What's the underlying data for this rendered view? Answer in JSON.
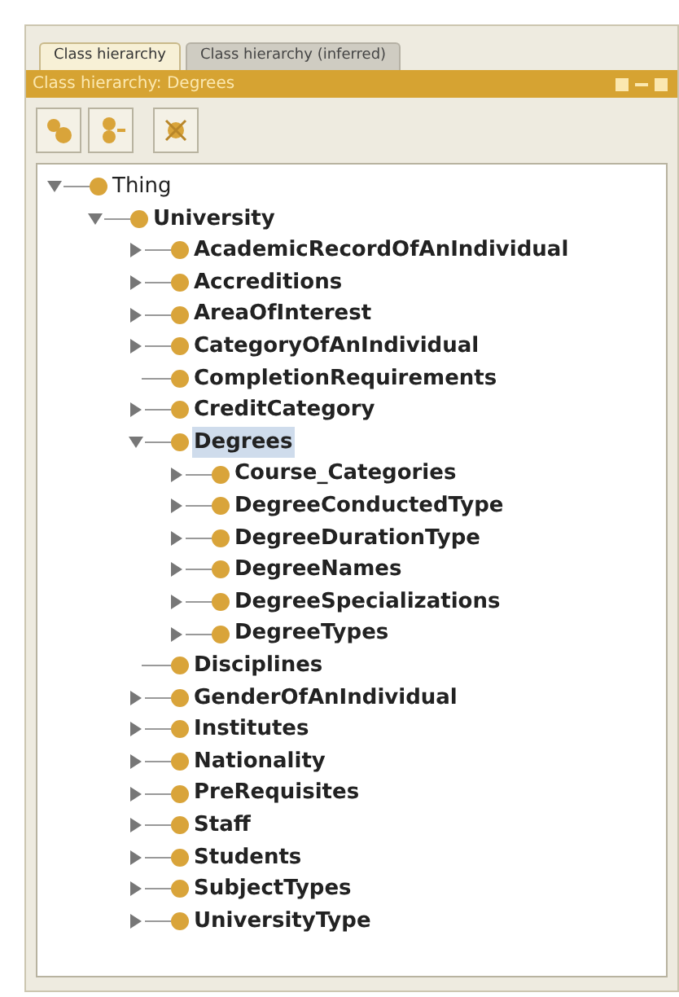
{
  "tabs": [
    {
      "label": "Class hierarchy",
      "selected": true
    },
    {
      "label": "Class hierarchy (inferred)",
      "selected": false
    }
  ],
  "view_title": "Class hierarchy: Degrees",
  "tree": [
    {
      "label": "Thing",
      "kind": "folder",
      "expanded": true,
      "selected": false,
      "children": [
        {
          "label": "University",
          "kind": "folder",
          "expanded": true,
          "selected": false,
          "children": [
            {
              "label": "AcademicRecordOfAnIndividual",
              "kind": "folder",
              "expanded": false,
              "selected": false
            },
            {
              "label": "Accreditions",
              "kind": "folder",
              "expanded": false,
              "selected": false
            },
            {
              "label": "AreaOfInterest",
              "kind": "folder",
              "expanded": false,
              "selected": false
            },
            {
              "label": "CategoryOfAnIndividual",
              "kind": "folder",
              "expanded": false,
              "selected": false
            },
            {
              "label": "CompletionRequirements",
              "kind": "leaf",
              "selected": false
            },
            {
              "label": "CreditCategory",
              "kind": "folder",
              "expanded": false,
              "selected": false
            },
            {
              "label": "Degrees",
              "kind": "folder",
              "expanded": true,
              "selected": true,
              "children": [
                {
                  "label": "Course_Categories",
                  "kind": "folder",
                  "expanded": false,
                  "selected": false
                },
                {
                  "label": "DegreeConductedType",
                  "kind": "folder",
                  "expanded": false,
                  "selected": false
                },
                {
                  "label": "DegreeDurationType",
                  "kind": "folder",
                  "expanded": false,
                  "selected": false
                },
                {
                  "label": "DegreeNames",
                  "kind": "folder",
                  "expanded": false,
                  "selected": false
                },
                {
                  "label": "DegreeSpecializations",
                  "kind": "folder",
                  "expanded": false,
                  "selected": false
                },
                {
                  "label": "DegreeTypes",
                  "kind": "folder",
                  "expanded": false,
                  "selected": false
                }
              ]
            },
            {
              "label": "Disciplines",
              "kind": "leaf",
              "selected": false
            },
            {
              "label": "GenderOfAnIndividual",
              "kind": "folder",
              "expanded": false,
              "selected": false
            },
            {
              "label": "Institutes",
              "kind": "folder",
              "expanded": false,
              "selected": false
            },
            {
              "label": "Nationality",
              "kind": "folder",
              "expanded": false,
              "selected": false
            },
            {
              "label": "PreRequisites",
              "kind": "folder",
              "expanded": false,
              "selected": false
            },
            {
              "label": "Staff",
              "kind": "folder",
              "expanded": false,
              "selected": false
            },
            {
              "label": "Students",
              "kind": "folder",
              "expanded": false,
              "selected": false
            },
            {
              "label": "SubjectTypes",
              "kind": "folder",
              "expanded": false,
              "selected": false
            },
            {
              "label": "UniversityType",
              "kind": "folder",
              "expanded": false,
              "selected": false
            }
          ]
        }
      ]
    }
  ]
}
